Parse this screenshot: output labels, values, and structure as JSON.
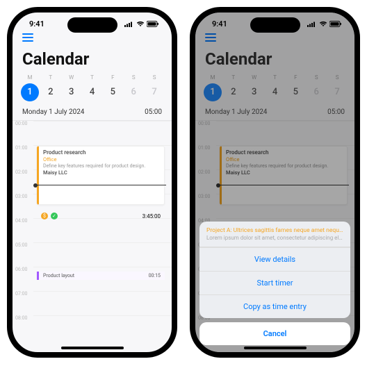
{
  "status": {
    "time": "9:41"
  },
  "page_title": "Calendar",
  "week": {
    "labels": [
      "M",
      "T",
      "W",
      "T",
      "F",
      "S",
      "S"
    ],
    "days": [
      "1",
      "2",
      "3",
      "4",
      "5",
      "6",
      "7"
    ]
  },
  "day_header": {
    "date": "Monday 1 July 2024",
    "time": "05:00"
  },
  "hours": [
    "00:00",
    "01:00",
    "02:00",
    "03:00",
    "04:00",
    "05:00",
    "06:00",
    "07:00",
    "08:00"
  ],
  "event1": {
    "title": "Product research",
    "project": "Office",
    "desc": "Define key features required for product design.",
    "client": "Maisy LLC"
  },
  "timer": {
    "elapsed": "3:45:00"
  },
  "event2": {
    "title": "Product layout",
    "dur": "00:15"
  },
  "sheet": {
    "title": "Project A: Ultrices sagittis fames neque amet neque ne...",
    "subtitle": "Lorem ipsum dolor sit amet, consectetur adipiscing elit...",
    "opt1": "View details",
    "opt2": "Start timer",
    "opt3": "Copy as time entry",
    "cancel": "Cancel"
  }
}
